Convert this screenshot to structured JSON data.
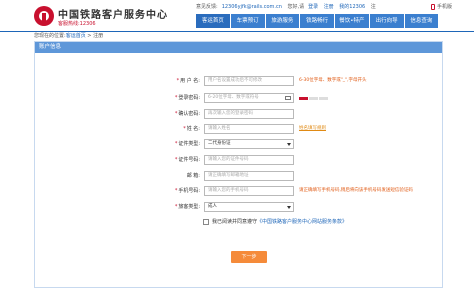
{
  "header": {
    "logo_title": "中国铁路客户服务中心",
    "logo_sub": "客服热线:12306",
    "topbar": {
      "greeting": "意见反馈:",
      "email": "12306yjfk@rails.com.cn",
      "hello": "您好,请",
      "login": "登录",
      "register": "注册",
      "my12306": "我的12306",
      "lang": "注",
      "mobile": "手机版"
    },
    "nav": [
      "客运首页",
      "车票预订",
      "旅游服务",
      "铁路畅行",
      "餐饮•特产",
      "出行向导",
      "信息查询"
    ],
    "nav_active_index": 0
  },
  "breadcrumb": {
    "prefix": "您现在的位置:",
    "home": "客运首页",
    "sep": ">",
    "current": "注册"
  },
  "panel": {
    "title": "账户信息"
  },
  "form": {
    "username": {
      "label": "用 户 名:",
      "placeholder": "用户名设置成功后不可修改",
      "hint": "6-30位字母、数字或\"_\",字母开头"
    },
    "password": {
      "label": "登录密码:",
      "placeholder": "6-20位字母、数字或符号"
    },
    "confirm": {
      "label": "确认密码:",
      "placeholder": "再次输入您的登录密码"
    },
    "name": {
      "label": "姓    名:",
      "placeholder": "请输入姓名",
      "hint": "姓名填写规则"
    },
    "id_type": {
      "label": "证件类型:",
      "value": "二代身份证"
    },
    "id_number": {
      "label": "证件号码:",
      "placeholder": "请输入您的证件号码"
    },
    "email": {
      "label": "邮    箱:",
      "placeholder": "请正确填写邮箱地址"
    },
    "phone": {
      "label": "手机号码:",
      "placeholder": "请输入您的手机号码",
      "hint": "请正确填写手机号码,稍后将向该手机号码发送短信验证码"
    },
    "passenger_type": {
      "label": "旅客类型:",
      "value": "成人"
    },
    "agree": {
      "text": "我已阅读并同意遵守",
      "link": "《中国铁路客户服务中心网站服务条款》"
    },
    "next_button": "下一步"
  },
  "colors": {
    "brand_red": "#c8102e",
    "nav_blue": "#3b7fcf",
    "panel_head": "#5e97d9",
    "button_orange": "#f58b3a"
  }
}
